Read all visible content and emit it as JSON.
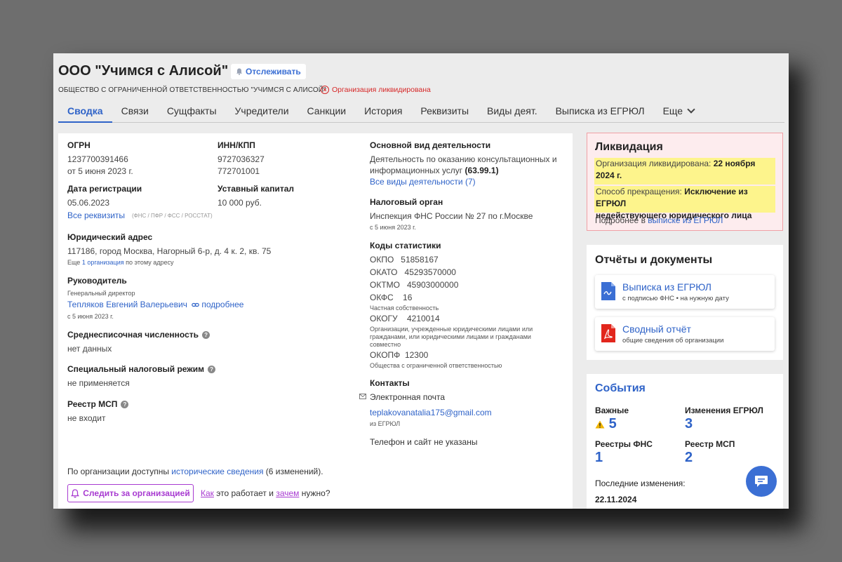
{
  "header": {
    "org_title": "ООО \"Учимся с Алисой\"",
    "track_label": "Отслеживать",
    "full_name": "ОБЩЕСТВО С ОГРАНИЧЕННОЙ ОТВЕТСТВЕННОСТЬЮ \"УЧИМСЯ С АЛИСОЙ\"",
    "status": "Организация ликвидирована",
    "status_color": "#d62828",
    "accent_color": "#2f63c8"
  },
  "tabs": [
    {
      "label": "Сводка"
    },
    {
      "label": "Связи"
    },
    {
      "label": "Сущфакты"
    },
    {
      "label": "Учредители"
    },
    {
      "label": "Санкции"
    },
    {
      "label": "История"
    },
    {
      "label": "Реквизиты"
    },
    {
      "label": "Виды деят."
    },
    {
      "label": "Выписка из ЕГРЮЛ"
    },
    {
      "label": "Еще"
    }
  ],
  "summary": {
    "ogrn_label": "ОГРН",
    "ogrn_value": "1237700391466",
    "ogrn_date": "от 5 июня 2023 г.",
    "inn_label": "ИНН/КПП",
    "inn_value": "9727036327",
    "kpp_value": "772701001",
    "reg_label": "Дата регистрации",
    "reg_value": "05.06.2023",
    "capital_label": "Уставный капитал",
    "capital_value": "10 000 руб.",
    "all_req_link": "Все реквизиты",
    "all_req_note": "(ФНС / ПФР / ФСС / РОССТАТ)",
    "address_label": "Юридический адрес",
    "address_value": "117186, город Москва, Нагорный 6-р, д. 4 к. 2, кв. 75",
    "address_note_pre": "Еще",
    "address_note_link": "1 организация",
    "address_note_post": "по этому адресу",
    "head_label": "Руководитель",
    "head_role": "Генеральный директор",
    "head_name": "Тепляков Евгений Валерьевич",
    "head_more": "подробнее",
    "head_date": "с 5 июня 2023 г.",
    "staff_label": "Среднесписочная численность",
    "staff_value": "нет данных",
    "tax_label": "Специальный налоговый режим",
    "tax_value": "не применяется",
    "msp_label": "Реестр МСП",
    "msp_value": "не входит",
    "activity_label": "Основной вид деятельности",
    "activity_line1": "Деятельность по оказанию консультационных и",
    "activity_line2": "информационных услуг",
    "activity_code": "(63.99.1)",
    "activity_all": "Все виды деятельности (7)",
    "tax_org_label": "Налоговый орган",
    "tax_org_value": "Инспекция ФНС России № 27 по г.Москве",
    "tax_org_date": "с 5 июня 2023 г.",
    "codes_label": "Коды статистики",
    "okpo": "ОКПО   51858167",
    "okato": "ОКАТО   45293570000",
    "oktmo": "ОКТМО   45903000000",
    "okfs": "ОКФС    16",
    "okfs_note": "Частная собственность",
    "okogu": "ОКОГУ    4210014",
    "okogu_note1": "Организации, учрежденные юридическими лицами или",
    "okogu_note2": "гражданами, или юридическими лицами и гражданами",
    "okogu_note3": "совместно",
    "okopf": "ОКОПФ  12300",
    "okopf_note": "Общества с ограниченной ответственностью",
    "contacts_label": "Контакты",
    "email_label": "Электронная почта",
    "email_value": "teplakovanatalia175@gmail.com",
    "email_source": "из ЕГРЮЛ",
    "phone_note": "Телефон и сайт не указаны",
    "history_pre": "По организации доступны",
    "history_link": "исторические сведения",
    "history_post": "(6 изменений).",
    "follow_label": "Следить за организацией",
    "how_link": "Как",
    "how_mid": "это работает и",
    "why_link": "зачем",
    "why_post": "нужно?"
  },
  "liquidation": {
    "title": "Ликвидация",
    "date_label": "Организация ликвидирована:",
    "date_value_1": "22 ноября",
    "date_value_2": "2024 г.",
    "method_label": "Способ прекращения:",
    "method_value_1": "Исключение из ЕГРЮЛ",
    "method_value_2": "недействующего юридического лица",
    "more_pre": "Подробнее в",
    "more_link": "выписке из ЕГРЮЛ"
  },
  "documents": {
    "title": "Отчёты и документы",
    "items": [
      {
        "title": "Выписка из ЕГРЮЛ",
        "subtitle": "с подписью ФНС • на нужную дату"
      },
      {
        "title": "Сводный отчёт",
        "subtitle": "общие сведения об организации"
      }
    ]
  },
  "events": {
    "title": "События",
    "important_label": "Важные",
    "important_value": "5",
    "egrul_label": "Изменения ЕГРЮЛ",
    "egrul_value": "3",
    "fns_label": "Реестры ФНС",
    "fns_value": "1",
    "msp_label": "Реестр МСП",
    "msp_value": "2",
    "last_label": "Последние изменения:",
    "last_date": "22.11.2024"
  }
}
